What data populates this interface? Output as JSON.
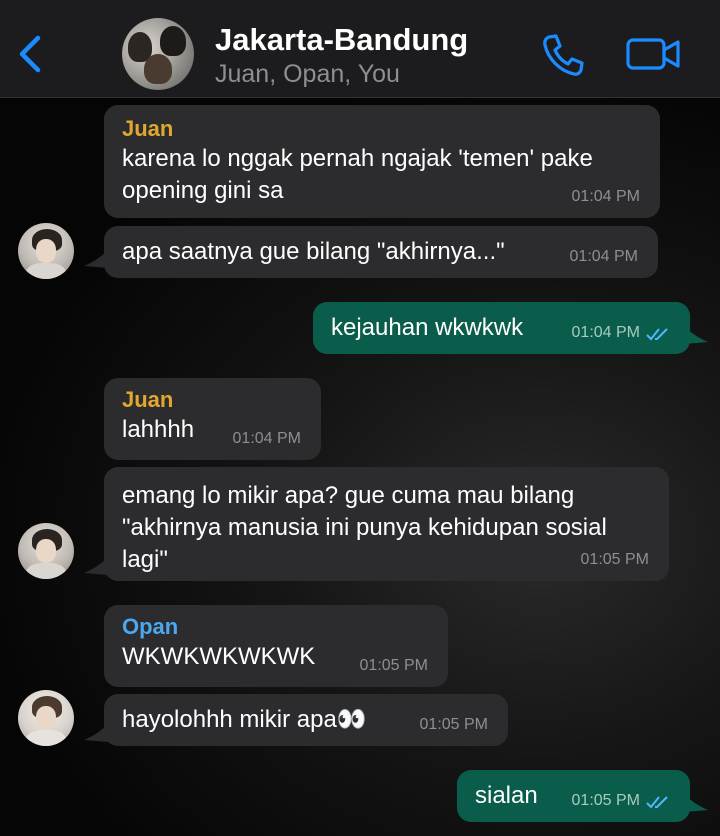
{
  "header": {
    "title": "Jakarta-Bandung",
    "subtitle": "Juan, Opan, You"
  },
  "colors": {
    "accent": "#1a8cff",
    "juan": "#e0a82e",
    "opan": "#4aa8f0",
    "incoming_bubble": "#2c2c2e",
    "outgoing_bubble": "#0b5d4b"
  },
  "messages": [
    {
      "sender": "Juan",
      "text_lines": [
        "karena lo nggak pernah ngajak 'temen' pake",
        "opening gini sa"
      ],
      "time": "01:04 PM"
    },
    {
      "text": "apa saatnya gue bilang \"akhirnya...\"",
      "time": "01:04 PM"
    },
    {
      "text": "kejauhan wkwkwk",
      "time": "01:04 PM"
    },
    {
      "sender": "Juan",
      "text": "lahhhh",
      "time": "01:04 PM"
    },
    {
      "text_lines": [
        "emang lo mikir apa? gue cuma mau bilang",
        "\"akhirnya manusia ini punya kehidupan sosial",
        "lagi\""
      ],
      "time": "01:05 PM"
    },
    {
      "sender": "Opan",
      "text": "WKWKWKWKWK",
      "time": "01:05 PM"
    },
    {
      "text": "hayolohhh mikir apa👀",
      "time": "01:05 PM"
    },
    {
      "text": "sialan",
      "time": "01:05 PM"
    }
  ]
}
